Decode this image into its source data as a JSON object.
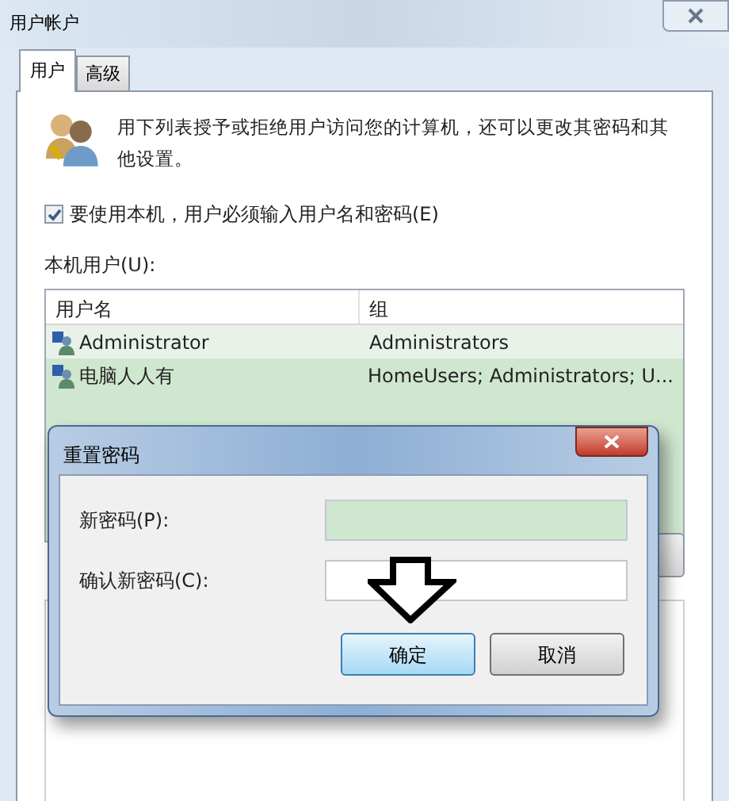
{
  "window": {
    "title": "用户帐户"
  },
  "tabs": [
    {
      "label": "用户",
      "selected": true
    },
    {
      "label": "高级",
      "selected": false
    }
  ],
  "description": "用下列表授予或拒绝用户访问您的计算机，还可以更改其密码和其他设置。",
  "require_login": {
    "label": "要使用本机，用户必须输入用户名和密码(E)",
    "checked": true
  },
  "users_label": "本机用户(U):",
  "table": {
    "columns": [
      "用户名",
      "组"
    ],
    "rows": [
      {
        "cells": [
          "Administrator",
          "Administrators"
        ],
        "selected": false
      },
      {
        "cells": [
          "电脑人人有",
          "HomeUsers; Administrators; U..."
        ],
        "selected": true
      }
    ]
  },
  "dialog": {
    "title": "重置密码",
    "fields": [
      {
        "label": "新密码(P):"
      },
      {
        "label": "确认新密码(C):"
      }
    ],
    "buttons": [
      {
        "label": "确定",
        "default": true
      },
      {
        "label": "取消",
        "default": false
      }
    ]
  }
}
